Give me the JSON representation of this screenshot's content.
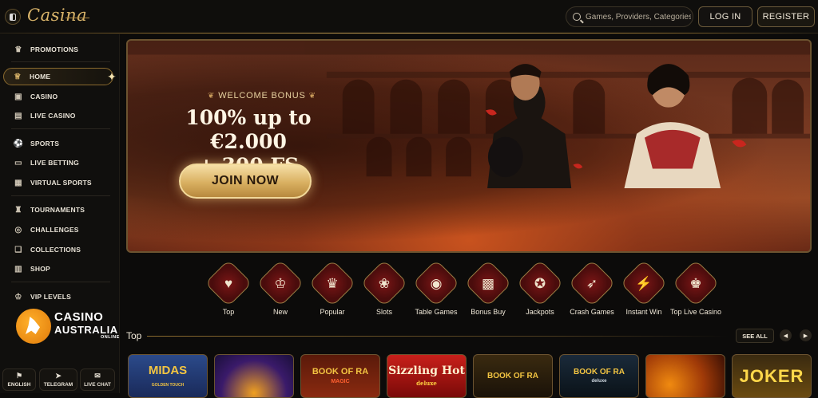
{
  "header": {
    "logo_text": "Casina",
    "search_placeholder": "Games, Providers, Categories",
    "login_label": "LOG IN",
    "register_label": "REGISTER"
  },
  "sidebar": {
    "items": [
      {
        "label": "PROMOTIONS",
        "icon": "gift-icon"
      },
      {
        "label": "HOME",
        "icon": "crown-icon",
        "active": true
      },
      {
        "label": "CASINO",
        "icon": "cards-icon"
      },
      {
        "label": "LIVE CASINO",
        "icon": "live-casino-icon"
      },
      {
        "label": "SPORTS",
        "icon": "soccer-ball-icon"
      },
      {
        "label": "LIVE BETTING",
        "icon": "live-tv-icon"
      },
      {
        "label": "VIRTUAL SPORTS",
        "icon": "monitor-icon"
      },
      {
        "label": "TOURNAMENTS",
        "icon": "trophy-icon"
      },
      {
        "label": "CHALLENGES",
        "icon": "target-icon"
      },
      {
        "label": "COLLECTIONS",
        "icon": "collection-icon"
      },
      {
        "label": "SHOP",
        "icon": "shop-icon"
      },
      {
        "label": "VIP LEVELS",
        "icon": "vip-icon"
      }
    ],
    "brand": {
      "line1": "CASINO",
      "line2": "AUSTRALIA",
      "line3": "ONLINE"
    },
    "bottom": [
      {
        "label": "ENGLISH",
        "icon": "flag-icon"
      },
      {
        "label": "TELEGRAM",
        "icon": "telegram-icon"
      },
      {
        "label": "LIVE CHAT",
        "icon": "chat-icon"
      }
    ]
  },
  "banner": {
    "welcome": "WELCOME BONUS",
    "headline_line1": "100% up to €2.000",
    "headline_line2": "+ 300 FS",
    "cta": "JOIN NOW"
  },
  "categories": [
    {
      "label": "Top",
      "icon": "top-icon"
    },
    {
      "label": "New",
      "icon": "new-icon"
    },
    {
      "label": "Popular",
      "icon": "popular-icon"
    },
    {
      "label": "Slots",
      "icon": "slots-icon"
    },
    {
      "label": "Table Games",
      "icon": "table-games-icon"
    },
    {
      "label": "Bonus Buy",
      "icon": "bonus-buy-icon"
    },
    {
      "label": "Jackpots",
      "icon": "jackpots-icon"
    },
    {
      "label": "Crash Games",
      "icon": "crash-games-icon"
    },
    {
      "label": "Instant Win",
      "icon": "instant-win-icon"
    },
    {
      "label": "Top Live Casino",
      "icon": "top-live-casino-icon"
    }
  ],
  "top_section": {
    "title": "Top",
    "see_all": "SEE ALL",
    "games": [
      {
        "name": "MIDAS",
        "sub": "GOLDEN TOUCH"
      },
      {
        "name": "",
        "sub": ""
      },
      {
        "name": "BOOK OF RA",
        "sub": "MAGIC"
      },
      {
        "name": "Sizzling Hot",
        "sub": "deluxe"
      },
      {
        "name": "BOOK OF RA",
        "sub": ""
      },
      {
        "name": "BOOK OF RA",
        "sub": "deluxe"
      },
      {
        "name": "",
        "sub": ""
      },
      {
        "name": "JOKER",
        "sub": ""
      }
    ]
  }
}
